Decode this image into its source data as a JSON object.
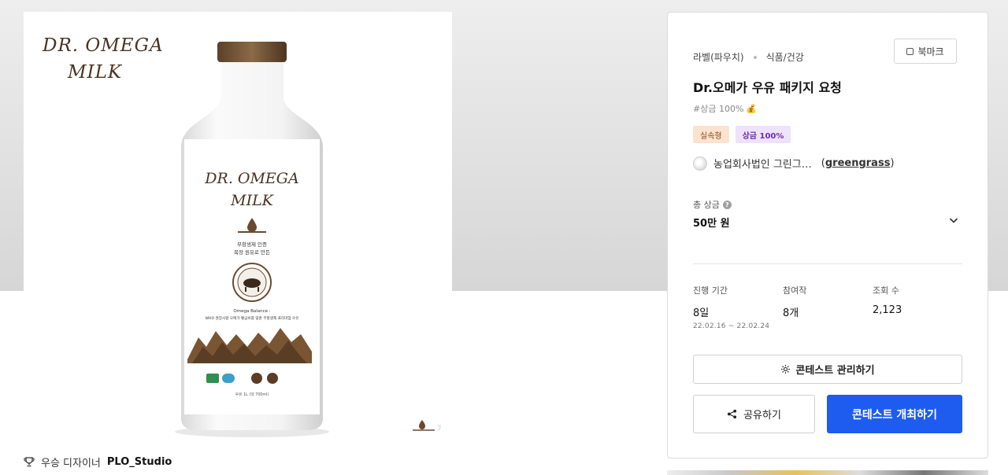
{
  "image": {
    "brand_line1": "DR. OMEGA",
    "brand_line2": "MILK",
    "bottle_line1": "DR. OMEGA",
    "bottle_line2": "MILK",
    "bottle_copy1": "무항생제 인증",
    "bottle_copy2": "목장 원유로 만든",
    "bottle_balance": "Omega Balance :",
    "bottle_desc": "WHO 권장사항 오메가 황금비를 맞춘 무항생제 프리미엄 우유",
    "bottle_volume": "우유 1L (약 700ml)"
  },
  "designer": {
    "prefix": "우승 디자이너",
    "name": "PLO_Studio"
  },
  "panel": {
    "category": "라벨(파우치)",
    "subcategory": "식품/건강",
    "bookmark_label": "북마크",
    "title": "Dr.오메가 우유 패키지 요청",
    "tagline": "#상금 100%",
    "tagline_emoji": "💰",
    "badges": [
      "실속형",
      "상금 100%"
    ],
    "company_name": "농업회사법인 그린그…",
    "company_handle": "greengrass",
    "total_prize_label": "총 상금",
    "total_prize_value": "50만 원",
    "stats": [
      {
        "label": "진행 기간",
        "value": "8일",
        "sub": "22.02.16 ~ 22.02.24"
      },
      {
        "label": "참여작",
        "value": "8개"
      },
      {
        "label": "조회 수",
        "value": "2,123"
      }
    ],
    "manage_label": "콘테스트 관리하기",
    "share_label": "공유하기",
    "open_label": "콘테스트 개최하기"
  },
  "colors": {
    "primary": "#1e5cf0",
    "badge_practical_bg": "#fbe3cf",
    "badge_prize_bg": "#efe2fb",
    "label_brown": "#4a3323"
  }
}
